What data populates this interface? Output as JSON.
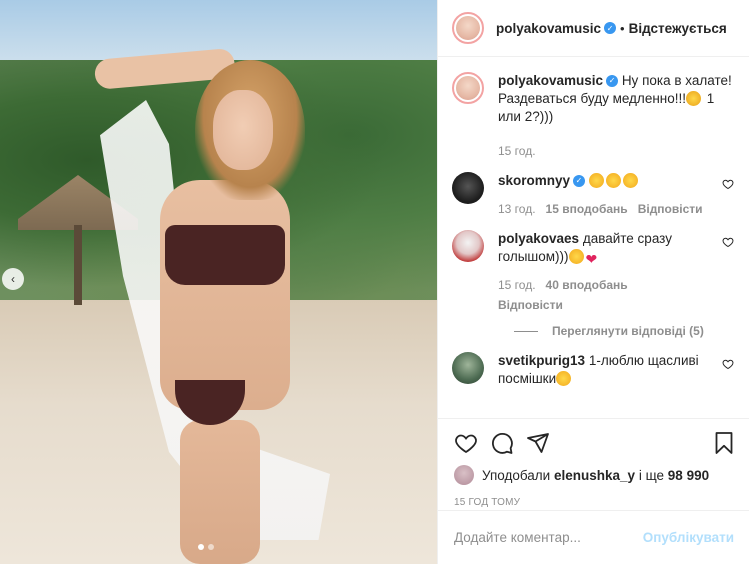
{
  "post": {
    "username": "polyakovamusic",
    "follow_status": "Відстежується",
    "separator": "•",
    "caption": "Ну пока в халате! Раздеваться буду медленно!!! 1 или 2?)))",
    "caption_time": "15 год."
  },
  "comments": [
    {
      "username": "skoromnyy",
      "verified": true,
      "text": "",
      "emoji": [
        "star-struck",
        "star-struck",
        "star-struck"
      ],
      "time": "13 год.",
      "likes": "15 вподобань",
      "reply": "Відповісти"
    },
    {
      "username": "polyakovaes",
      "verified": false,
      "text": "давайте сразу голышом)))",
      "emoji": [
        "joy",
        "heart"
      ],
      "time": "15 год.",
      "likes": "40 вподобань",
      "reply": "Відповісти",
      "view_replies": "Переглянути відповіді (5)"
    },
    {
      "username": "svetikpurig13",
      "verified": false,
      "text": "1-люблю щасливі посмішки",
      "emoji": [
        "grin"
      ]
    }
  ],
  "footer": {
    "likes_prefix": "Уподобали",
    "likes_user": "elenushka_y",
    "likes_mid": "і ще",
    "likes_count": "98 990",
    "timestamp": "15 год тому",
    "comment_placeholder": "Додайте коментар...",
    "post_button": "Опублікувати"
  },
  "icons": {
    "like": "heart-outline-icon",
    "comment": "comment-bubble-icon",
    "share": "paper-plane-icon",
    "save": "bookmark-icon",
    "comment_like": "small-heart-outline-icon",
    "prev": "chevron-left-icon"
  },
  "colors": {
    "verified": "#3897f0",
    "muted": "#8e8e8e",
    "post_button": "#b2dffc"
  }
}
